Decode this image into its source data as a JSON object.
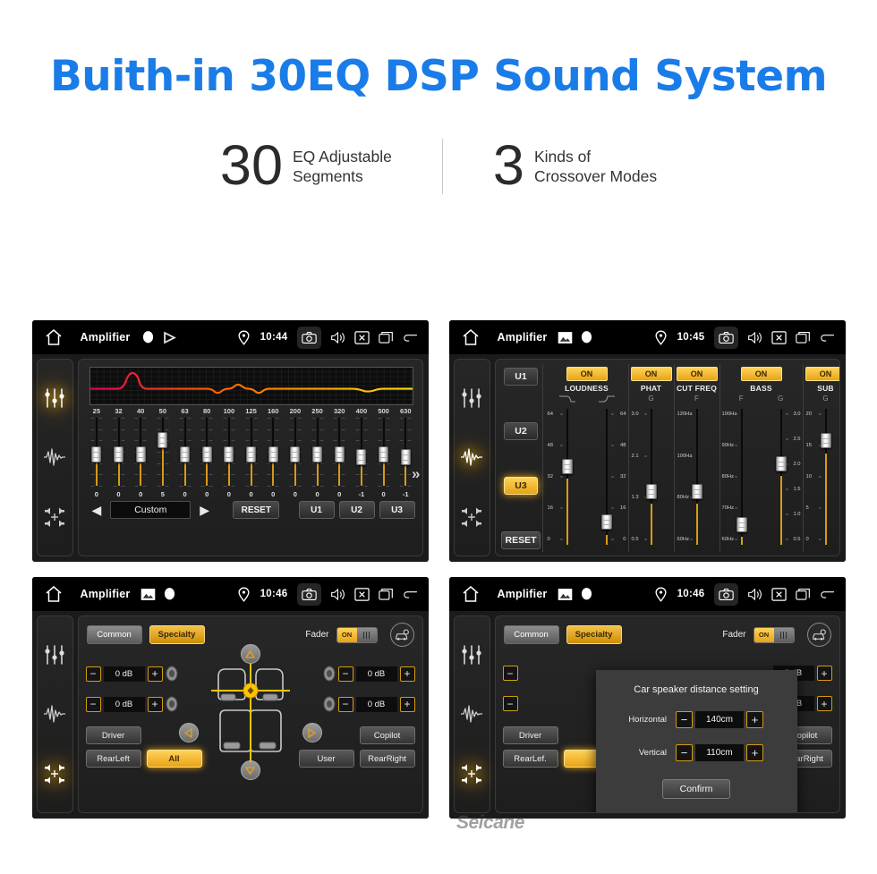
{
  "hero": {
    "title": "Buith-in 30EQ DSP Sound System",
    "stats": [
      {
        "number": "30",
        "label": "EQ Adjustable\nSegments"
      },
      {
        "number": "3",
        "label": "Kinds of\nCrossover Modes"
      }
    ]
  },
  "colors": {
    "title_blue": "#1a7ce8",
    "accent_amber": "#e8a317",
    "panel_bg": "#1b1b1b"
  },
  "watermark": "Seicane",
  "panels": {
    "eq": {
      "status": {
        "title": "Amplifier",
        "time": "10:44",
        "icons": [
          "home-icon",
          "record-icon",
          "play-icon",
          "location-icon",
          "camera-icon",
          "volume-icon",
          "close-icon",
          "recents-icon",
          "back-icon"
        ]
      },
      "rail": [
        "equalizer-icon",
        "waveform-icon",
        "balance-icon"
      ],
      "rail_active": 0,
      "frequencies": [
        "25",
        "32",
        "40",
        "50",
        "63",
        "80",
        "100",
        "125",
        "160",
        "200",
        "250",
        "320",
        "400",
        "500",
        "630"
      ],
      "values": [
        "0",
        "0",
        "0",
        "5",
        "0",
        "0",
        "0",
        "0",
        "0",
        "0",
        "0",
        "0",
        "-1",
        "0",
        "-1"
      ],
      "more_glyph": "»",
      "preset": "Custom",
      "prev_glyph": "◀",
      "next_glyph": "▶",
      "reset_label": "RESET",
      "user_buttons": [
        "U1",
        "U2",
        "U3"
      ]
    },
    "crossover": {
      "status": {
        "title": "Amplifier",
        "time": "10:45"
      },
      "rail": [
        "equalizer-icon",
        "waveform-icon",
        "balance-icon"
      ],
      "rail_active": 1,
      "presets": [
        "U1",
        "U2",
        "U3"
      ],
      "preset_active": "U3",
      "reset_label": "RESET",
      "columns": [
        {
          "on_label": "ON",
          "name": "LOUDNESS",
          "headers": [
            "",
            ""
          ],
          "sliders": [
            {
              "labels_left": [
                "64",
                "48",
                "32",
                "16",
                "0"
              ],
              "pos": 0.44
            },
            {
              "labels_right": [
                "64",
                "48",
                "32",
                "16",
                "0"
              ],
              "pos": 0.93
            }
          ]
        },
        {
          "on_label": "ON",
          "name": "PHAT",
          "headers": [
            "G"
          ],
          "sliders": [
            {
              "labels_left": [
                "3.0",
                "2.1",
                "1.3",
                "0.5"
              ],
              "pos": 0.66
            }
          ]
        },
        {
          "on_label": "ON",
          "name": "CUT FREQ",
          "headers": [
            "F"
          ],
          "sliders": [
            {
              "labels_left": [
                "120Hz",
                "100Hz",
                "80Hz",
                "60Hz"
              ],
              "pos": 0.66
            }
          ]
        },
        {
          "on_label": "ON",
          "name": "BASS",
          "headers": [
            "F",
            "G"
          ],
          "sliders": [
            {
              "labels_left": [
                "100Hz",
                "90Hz",
                "80Hz",
                "70Hz",
                "60Hz"
              ],
              "pos": 0.95
            },
            {
              "labels_right": [
                "3.0",
                "2.5",
                "2.0",
                "1.5",
                "1.0",
                "0.5"
              ],
              "pos": 0.42
            }
          ]
        },
        {
          "on_label": "ON",
          "name": "SUB",
          "headers": [
            "G"
          ],
          "sliders": [
            {
              "labels_left": [
                "20",
                "15",
                "10",
                "5",
                "0"
              ],
              "pos": 0.22
            }
          ]
        }
      ]
    },
    "fader": {
      "status": {
        "title": "Amplifier",
        "time": "10:46"
      },
      "rail": [
        "equalizer-icon",
        "waveform-icon",
        "balance-icon"
      ],
      "rail_active": 2,
      "tabs": [
        {
          "label": "Common",
          "active": false
        },
        {
          "label": "Specialty",
          "active": true
        }
      ],
      "fader_label": "Fader",
      "toggle_label": "ON",
      "car_icon": "car-settings-icon",
      "db_controls": [
        {
          "value": "0 dB",
          "minus": "−",
          "plus": "+",
          "name": "front-left-gain"
        },
        {
          "value": "0 dB",
          "minus": "−",
          "plus": "+",
          "name": "rear-left-gain"
        },
        {
          "value": "0 dB",
          "minus": "−",
          "plus": "+",
          "name": "front-right-gain"
        },
        {
          "value": "0 dB",
          "minus": "−",
          "plus": "+",
          "name": "rear-right-gain"
        }
      ],
      "position_buttons": [
        {
          "label": "Driver",
          "active": false
        },
        {
          "label": "RearLeft",
          "active": false
        },
        {
          "label": "All",
          "active": true
        },
        {
          "label": "Copilot",
          "active": false
        },
        {
          "label": "User",
          "active": false
        },
        {
          "label": "RearRight",
          "active": false
        }
      ]
    },
    "dialog_panel": {
      "status": {
        "title": "Amplifier",
        "time": "10:46"
      },
      "rail_active": 2,
      "tabs": [
        {
          "label": "Common",
          "active": false
        },
        {
          "label": "Specialty",
          "active": true
        }
      ],
      "fader_label": "Fader",
      "toggle_label": "ON",
      "dialog": {
        "title": "Car speaker distance setting",
        "rows": [
          {
            "label": "Horizontal",
            "value": "140cm",
            "minus": "−",
            "plus": "+"
          },
          {
            "label": "Vertical",
            "value": "110cm",
            "minus": "−",
            "plus": "+"
          }
        ],
        "confirm_label": "Confirm"
      },
      "position_buttons": [
        {
          "label": "Driver",
          "active": false
        },
        {
          "label": "RearLef.",
          "active": false
        },
        {
          "label": "Copilot",
          "active": false
        },
        {
          "label": "RearRight",
          "active": false
        }
      ]
    }
  }
}
